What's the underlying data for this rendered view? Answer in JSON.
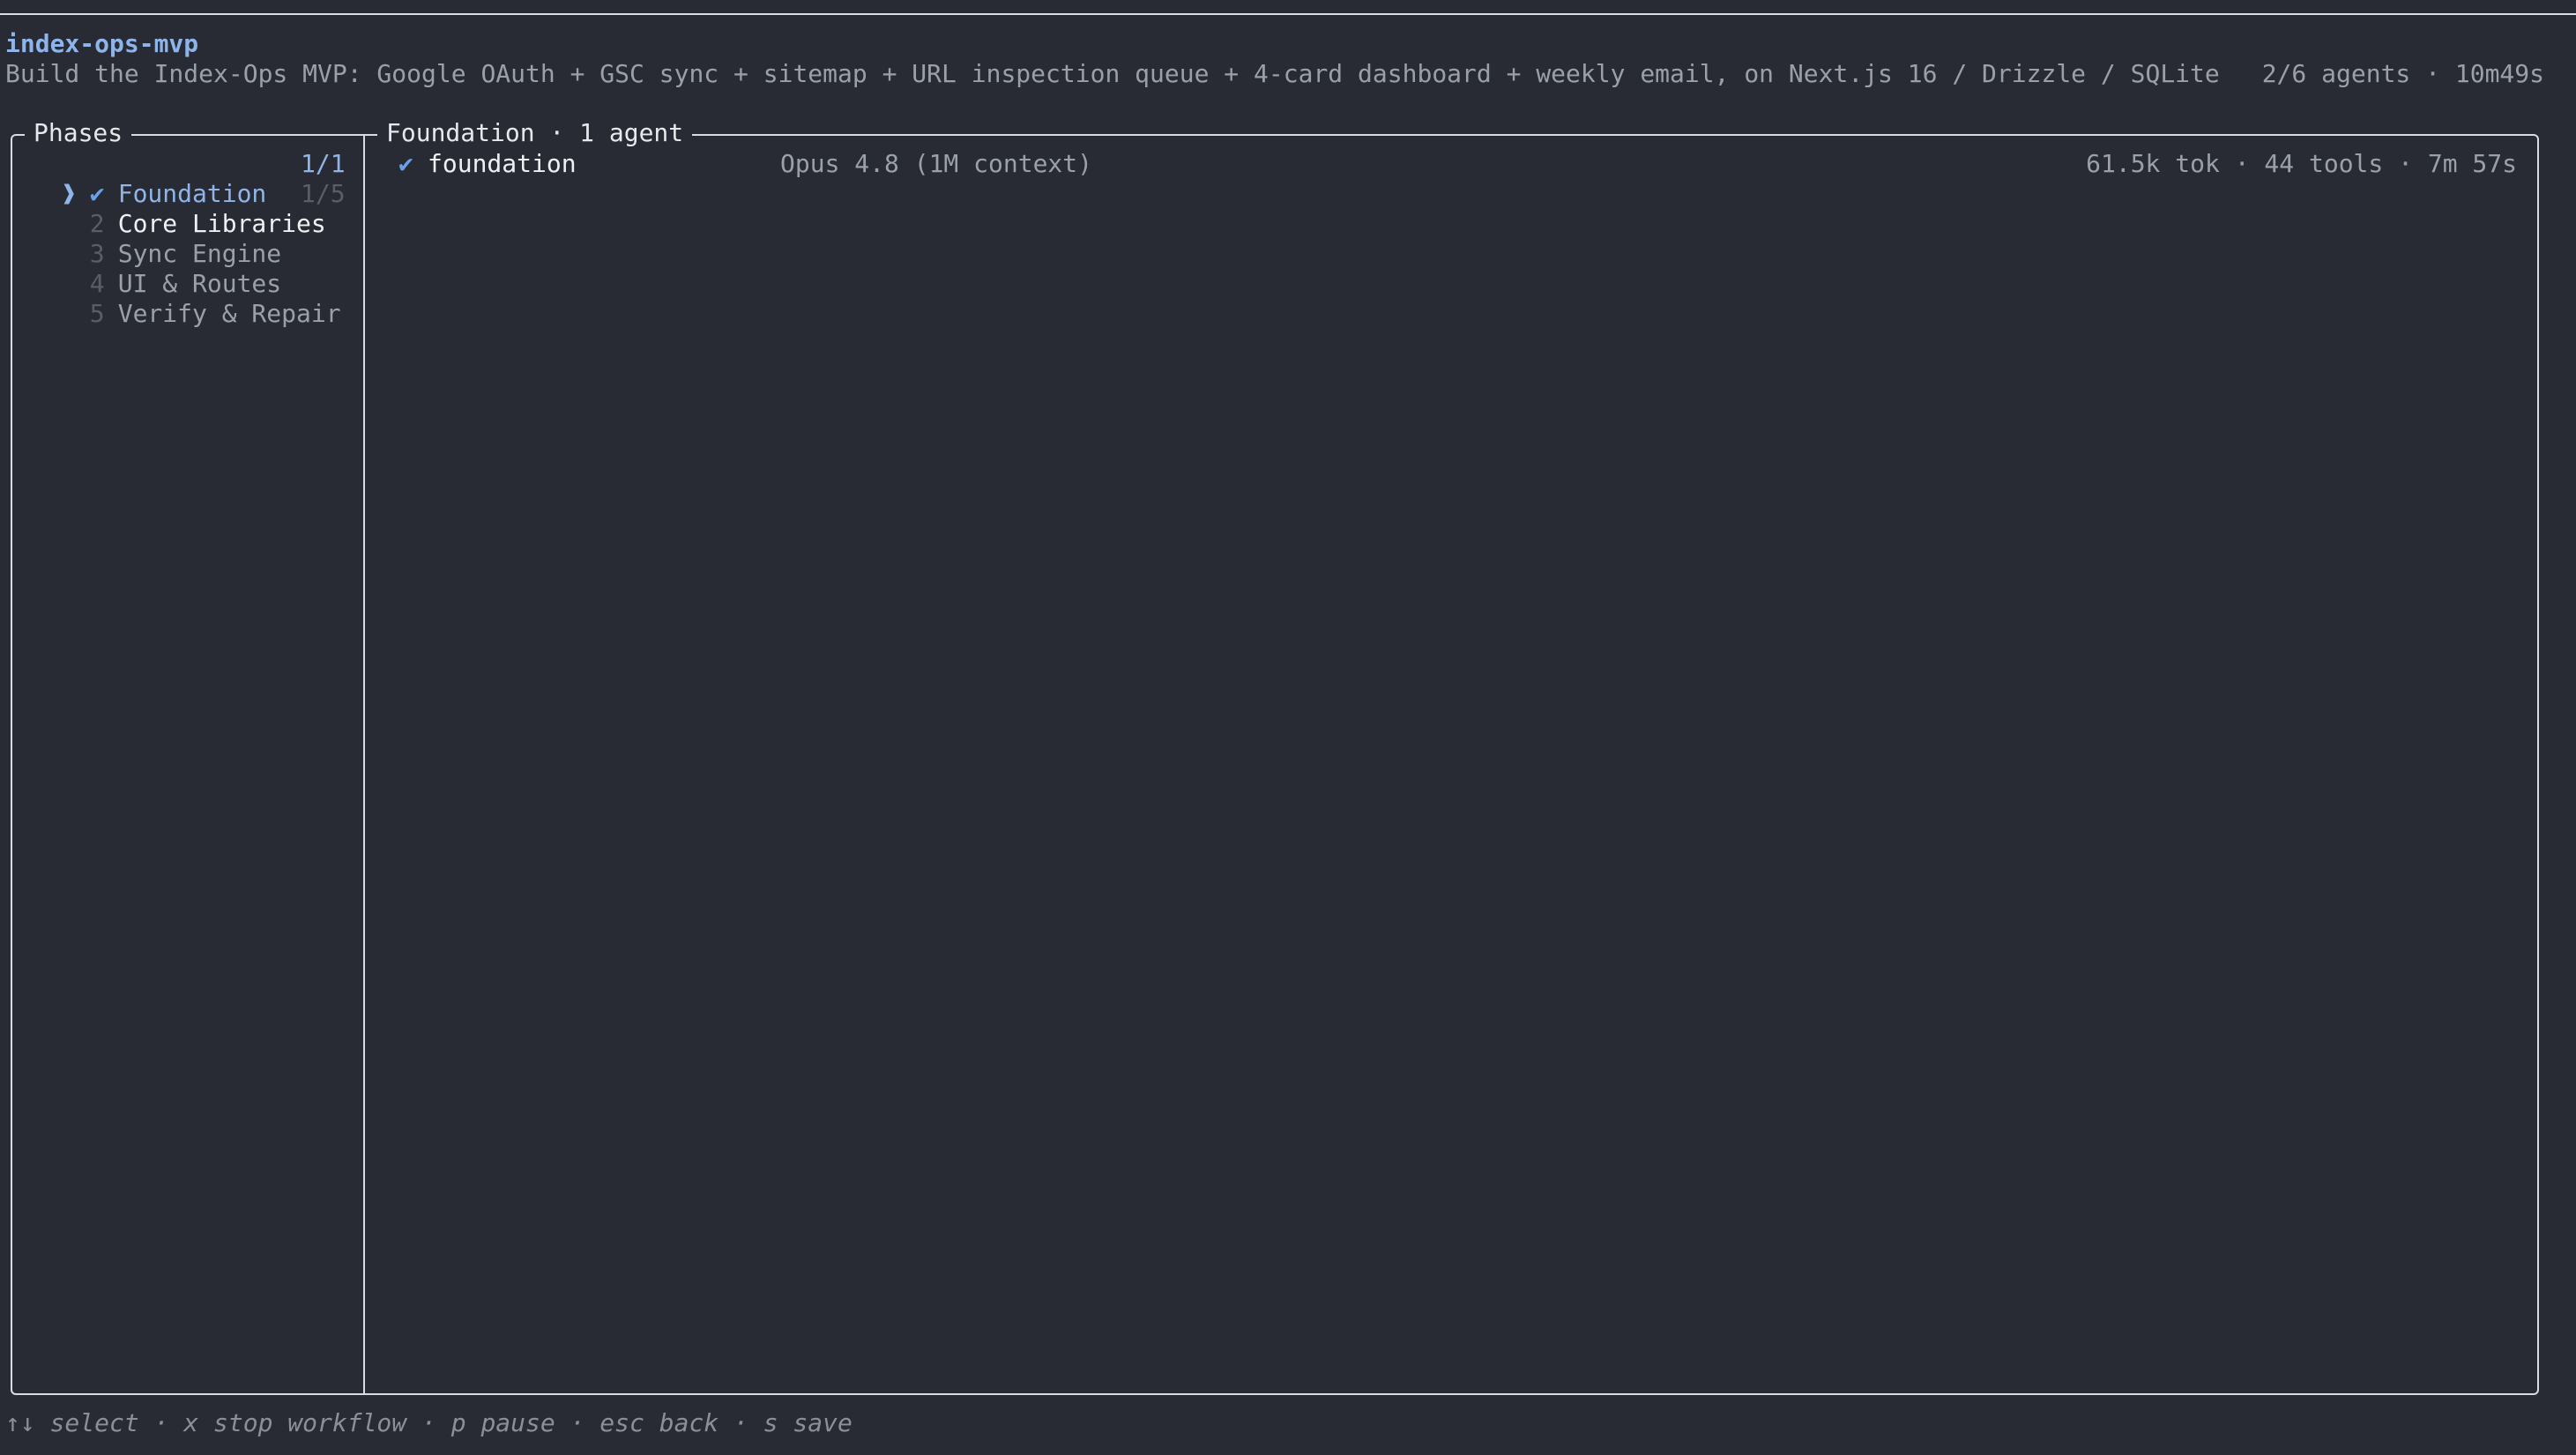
{
  "header": {
    "workflow_name": "index-ops-mvp",
    "description": "Build the Index-Ops MVP: Google OAuth + GSC sync + sitemap + URL inspection queue + 4-card dashboard + weekly email, on Next.js 16 / Drizzle / SQLite",
    "agent_summary": "2/6 agents · 10m49s"
  },
  "phases_panel": {
    "title": "Phases",
    "selected_caret": "❱",
    "items": [
      {
        "marker": "✔",
        "label": "Foundation",
        "count": "1/1"
      },
      {
        "marker": "2",
        "label": "Core Libraries",
        "count": "1/5"
      },
      {
        "marker": "3",
        "label": "Sync Engine",
        "count": ""
      },
      {
        "marker": "4",
        "label": "UI & Routes",
        "count": ""
      },
      {
        "marker": "5",
        "label": "Verify & Repair",
        "count": ""
      }
    ]
  },
  "main_panel": {
    "title": "Foundation · 1 agent",
    "agents": [
      {
        "status_icon": "✔",
        "name": "foundation",
        "model": "Opus 4.8 (1M context)",
        "stats": "61.5k tok · 44 tools · 7m 57s"
      }
    ]
  },
  "footer": {
    "hints": "↑↓ select · x stop workflow · p pause · esc back · s save"
  },
  "colors": {
    "background": "#282b33",
    "accent": "#8fb4ea",
    "check": "#6aa0e8",
    "border": "#d8dbe0",
    "muted": "#9aa0aa",
    "dim": "#585d68"
  }
}
